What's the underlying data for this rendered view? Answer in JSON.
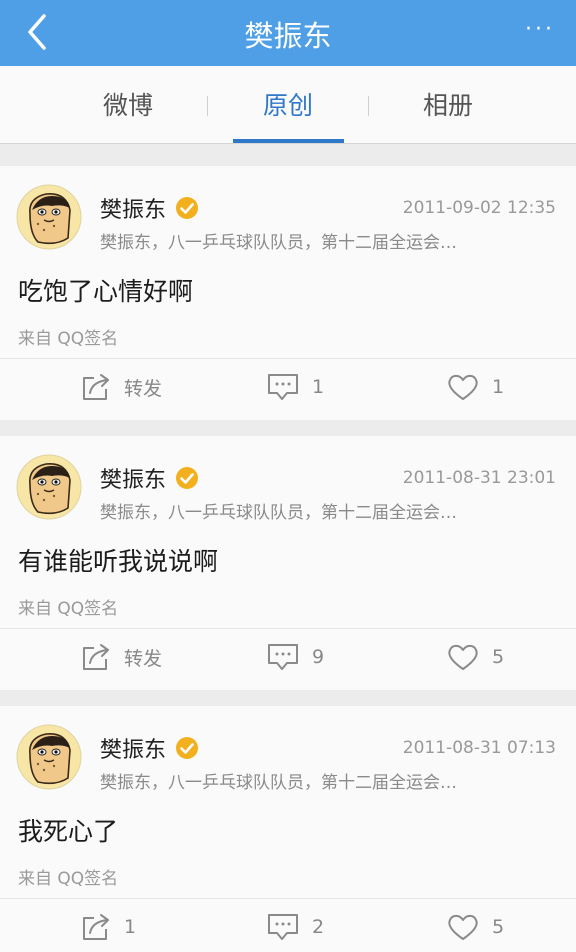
{
  "header": {
    "title": "樊振东",
    "more": "···"
  },
  "tabs": [
    {
      "label": "微博"
    },
    {
      "label": "原创"
    },
    {
      "label": "相册"
    }
  ],
  "posts": [
    {
      "user": "樊振东",
      "time": "2011-09-02 12:35",
      "desc": "樊振东，八一乒乓球队队员，第十二届全运会…",
      "content": "吃饱了心情好啊",
      "source": "来自 QQ签名",
      "repost_label": "转发",
      "comments": "1",
      "likes": "1"
    },
    {
      "user": "樊振东",
      "time": "2011-08-31 23:01",
      "desc": "樊振东，八一乒乓球队队员，第十二届全运会…",
      "content": "有谁能听我说说啊",
      "source": "来自 QQ签名",
      "repost_label": "转发",
      "comments": "9",
      "likes": "5"
    },
    {
      "user": "樊振东",
      "time": "2011-08-31 07:13",
      "desc": "樊振东，八一乒乓球队队员，第十二届全运会…",
      "content": "我死心了",
      "source": "来自 QQ签名",
      "repost_label": "1",
      "comments": "2",
      "likes": "5"
    }
  ],
  "colors": {
    "accent": "#4f9fe6",
    "tab_active": "#2f78c8",
    "verified": "#f2b01e"
  }
}
